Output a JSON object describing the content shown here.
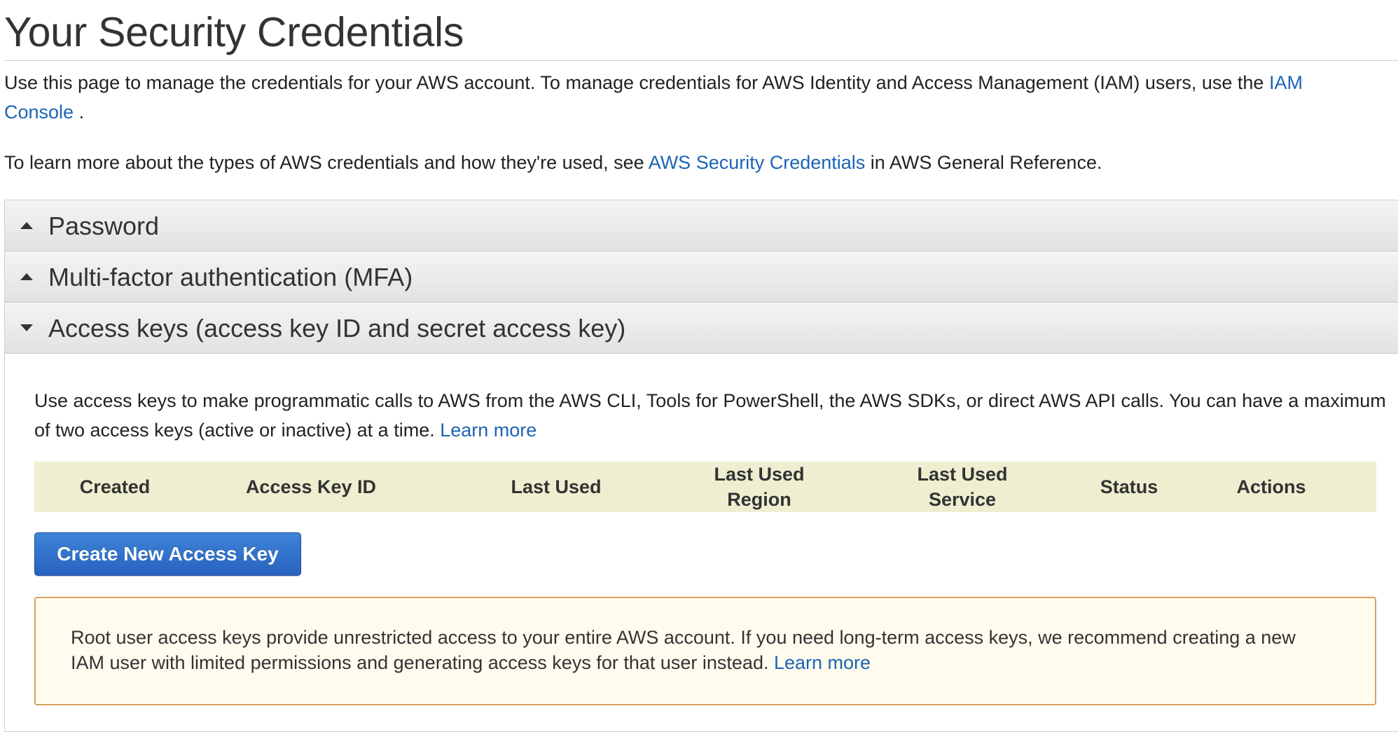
{
  "page": {
    "title": "Your Security Credentials",
    "intro_text": "Use this page to manage the credentials for your AWS account. To manage credentials for AWS Identity and Access Management (IAM) users, use the ",
    "intro_link": "IAM Console",
    "intro_end": " .",
    "intro2_text": "To learn more about the types of AWS credentials and how they're used, see ",
    "intro2_link": "AWS Security Credentials",
    "intro2_end": " in AWS General Reference."
  },
  "accordion": {
    "sections": [
      {
        "label": "Password",
        "expanded": false
      },
      {
        "label": "Multi-factor authentication (MFA)",
        "expanded": false
      },
      {
        "label": "Access keys (access key ID and secret access key)",
        "expanded": true
      }
    ]
  },
  "access_keys": {
    "description": "Use access keys to make programmatic calls to AWS from the AWS CLI, Tools for PowerShell, the AWS SDKs, or direct AWS API calls. You can have a maximum of two access keys (active or inactive) at a time. ",
    "learn_more": "Learn more",
    "table_headers": [
      {
        "line1": "Created",
        "line2": ""
      },
      {
        "line1": "Access Key ID",
        "line2": ""
      },
      {
        "line1": "Last Used",
        "line2": ""
      },
      {
        "line1": "Last Used",
        "line2": "Region"
      },
      {
        "line1": "Last Used",
        "line2": "Service"
      },
      {
        "line1": "Status",
        "line2": ""
      },
      {
        "line1": "Actions",
        "line2": ""
      }
    ],
    "create_button": "Create New Access Key",
    "warning_text": "Root user access keys provide unrestricted access to your entire AWS account. If you need long-term access keys, we recommend creating a new IAM user with limited permissions and generating access keys for that user instead. ",
    "warning_link": "Learn more"
  },
  "colors": {
    "link": "#1b64b5",
    "table_header_bg": "#eeefd0",
    "button_blue": "#2762bf",
    "warning_border": "#d6a25c",
    "warning_bg": "#fffbee"
  }
}
